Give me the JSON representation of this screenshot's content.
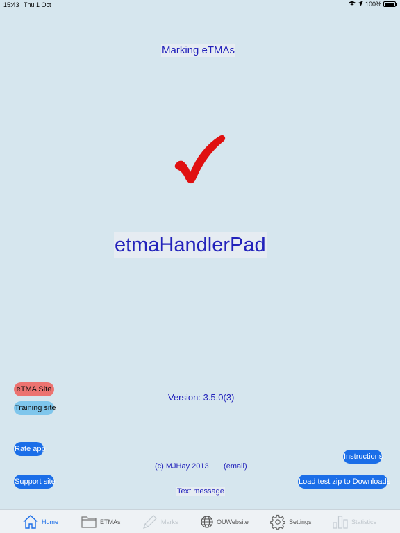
{
  "status_bar": {
    "time": "15:43",
    "date": "Thu 1 Oct",
    "battery": "100%",
    "wifi_icon": "wifi-icon",
    "location_icon": "location-arrow-icon",
    "battery_icon": "battery-icon"
  },
  "header": {
    "title": "Marking eTMAs"
  },
  "logo": {
    "icon": "checkmark-icon",
    "color": "#e01010"
  },
  "app": {
    "name": "etmaHandlerPad",
    "version": "Version: 3.5.0(3)",
    "copyright": "(c) MJHay 2013",
    "email": "(email)",
    "text_message": "Text message"
  },
  "buttons": {
    "etma_site": "eTMA Site",
    "training_site": "Training site",
    "rate_app": "Rate app",
    "support_site": "Support site",
    "instructions": "Instructions",
    "load_test_zip": "Load test zip to Downloads"
  },
  "colors": {
    "background": "#d6e6ee",
    "text_accent": "#2222bb",
    "pill_red": "#ec7370",
    "pill_cyan": "#7fc6ec",
    "pill_blue": "#1b6ee8",
    "tab_active": "#1b6ee8"
  },
  "tabs": [
    {
      "label": "Home",
      "icon": "home-icon",
      "active": true,
      "enabled": true
    },
    {
      "label": "ETMAs",
      "icon": "folder-icon",
      "active": false,
      "enabled": true
    },
    {
      "label": "Marks",
      "icon": "pen-icon",
      "active": false,
      "enabled": false
    },
    {
      "label": "OUWebsite",
      "icon": "globe-icon",
      "active": false,
      "enabled": true
    },
    {
      "label": "Settings",
      "icon": "gear-icon",
      "active": false,
      "enabled": true
    },
    {
      "label": "Statistics",
      "icon": "bar-chart-icon",
      "active": false,
      "enabled": false
    }
  ]
}
